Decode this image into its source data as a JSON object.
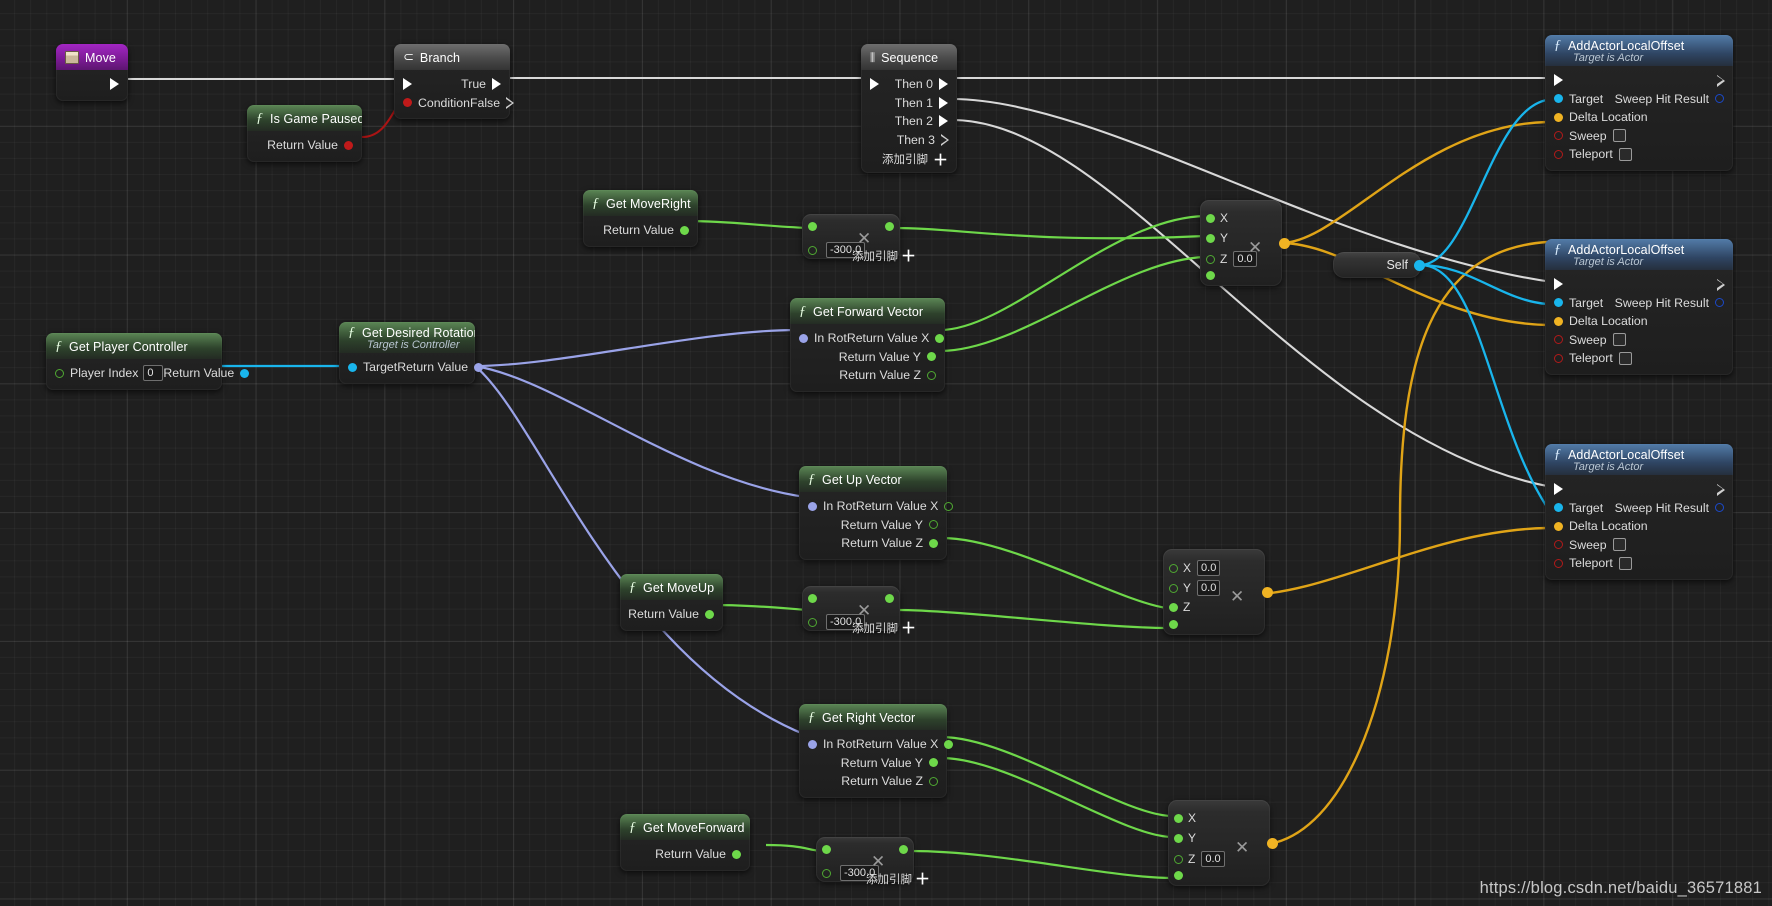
{
  "editor": {
    "name": "Unreal Engine Blueprint Event Graph",
    "watermark": "https://blog.csdn.net/baidu_36571881",
    "add_pin_label": "添加引脚",
    "colors": {
      "exec_white": "#ffffff",
      "float_green": "#6ed84a",
      "object_blue": "#19b5ec",
      "vector_yellow": "#f0b323",
      "rotator_lavender": "#9aa3e8",
      "bool_red": "#c01a1a",
      "background": "#1f1f1f"
    }
  },
  "nodes": {
    "move": {
      "title": "Move",
      "icon": "event-node-icon",
      "out_exec": ""
    },
    "is_game_paused": {
      "title": "Is Game Paused",
      "icon": "function-icon",
      "out_return": "Return Value"
    },
    "branch": {
      "title": "Branch",
      "icon": "branch-icon",
      "in_condition": "Condition",
      "out_true": "True",
      "out_false": "False"
    },
    "sequence": {
      "title": "Sequence",
      "icon": "sequence-icon",
      "outs": [
        "Then 0",
        "Then 1",
        "Then 2",
        "Then 3"
      ],
      "add_pin": "添加引脚"
    },
    "get_player_controller": {
      "title": "Get Player Controller",
      "icon": "function-icon",
      "in_label": "Player Index",
      "in_value": "0",
      "out_return": "Return Value"
    },
    "get_desired_rotation": {
      "title": "Get Desired Rotation",
      "subtitle": "Target is Controller",
      "icon": "function-icon",
      "in_target": "Target",
      "out_return": "Return Value"
    },
    "get_move_right": {
      "title": "Get MoveRight",
      "icon": "function-icon",
      "out_return": "Return Value"
    },
    "get_move_up": {
      "title": "Get MoveUp",
      "icon": "function-icon",
      "out_return": "Return Value"
    },
    "get_move_forward": {
      "title": "Get MoveForward",
      "icon": "function-icon",
      "out_return": "Return Value"
    },
    "get_forward_vector": {
      "title": "Get Forward Vector",
      "icon": "function-icon",
      "in_rot": "In Rot",
      "outs": [
        "Return Value X",
        "Return Value Y",
        "Return Value Z"
      ]
    },
    "get_up_vector": {
      "title": "Get Up Vector",
      "icon": "function-icon",
      "in_rot": "In Rot",
      "outs": [
        "Return Value X",
        "Return Value Y",
        "Return Value Z"
      ]
    },
    "get_right_vector": {
      "title": "Get Right Vector",
      "icon": "function-icon",
      "in_rot": "In Rot",
      "outs": [
        "Return Value X",
        "Return Value Y",
        "Return Value Z"
      ]
    },
    "multiply_right": {
      "operator": "✕",
      "value": "-300.0",
      "add_pin": "添加引脚"
    },
    "multiply_up": {
      "operator": "✕",
      "value": "-300.0",
      "add_pin": "添加引脚"
    },
    "multiply_forward": {
      "operator": "✕",
      "value": "-300.0",
      "add_pin": "添加引脚"
    },
    "make_vector_top": {
      "operator": "✕",
      "rows": [
        {
          "label": "X",
          "value": null
        },
        {
          "label": "Y",
          "value": null
        },
        {
          "label": "Z",
          "value": "0.0"
        }
      ]
    },
    "make_vector_mid": {
      "operator": "✕",
      "rows": [
        {
          "label": "X",
          "value": "0.0"
        },
        {
          "label": "Y",
          "value": "0.0"
        },
        {
          "label": "Z",
          "value": null
        }
      ]
    },
    "make_vector_bottom": {
      "operator": "✕",
      "rows": [
        {
          "label": "X",
          "value": null
        },
        {
          "label": "Y",
          "value": null
        },
        {
          "label": "Z",
          "value": "0.0"
        }
      ]
    },
    "self": {
      "label": "Self"
    },
    "add_actor_local_offset_1": {
      "title": "AddActorLocalOffset",
      "subtitle": "Target is Actor",
      "icon": "function-icon",
      "in_target": "Target",
      "in_delta": "Delta Location",
      "in_sweep": "Sweep",
      "in_teleport": "Teleport",
      "out_sweep_hit": "Sweep Hit Result"
    },
    "add_actor_local_offset_2": {
      "title": "AddActorLocalOffset",
      "subtitle": "Target is Actor",
      "icon": "function-icon",
      "in_target": "Target",
      "in_delta": "Delta Location",
      "in_sweep": "Sweep",
      "in_teleport": "Teleport",
      "out_sweep_hit": "Sweep Hit Result"
    },
    "add_actor_local_offset_3": {
      "title": "AddActorLocalOffset",
      "subtitle": "Target is Actor",
      "icon": "function-icon",
      "in_target": "Target",
      "in_delta": "Delta Location",
      "in_sweep": "Sweep",
      "in_teleport": "Teleport",
      "out_sweep_hit": "Sweep Hit Result"
    }
  }
}
